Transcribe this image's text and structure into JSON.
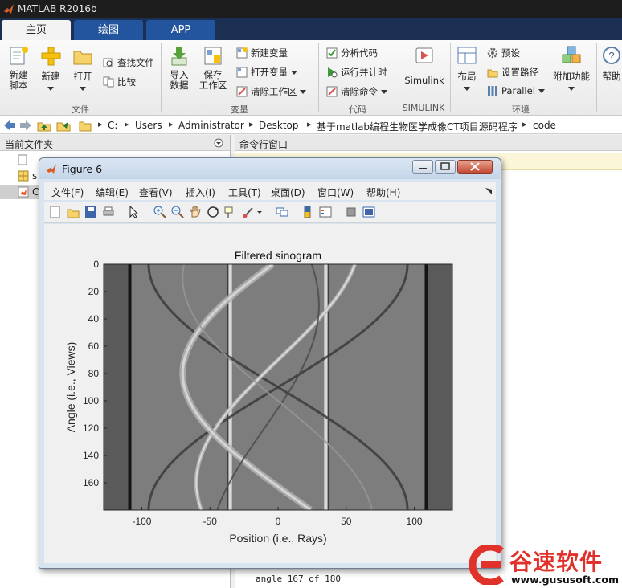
{
  "app": {
    "title": "MATLAB R2016b"
  },
  "tabs": [
    {
      "label": "主页",
      "active": true
    },
    {
      "label": "绘图",
      "active": false
    },
    {
      "label": "APP",
      "active": false
    }
  ],
  "ribbon": {
    "file": {
      "group": "文件",
      "new_script": "新建\n脚本",
      "new": "新建",
      "open": "打开",
      "find_files": "查找文件",
      "compare": "比较"
    },
    "variable": {
      "group": "变量",
      "import": "导入\n数据",
      "save_ws": "保存\n工作区",
      "new_var": "新建变量",
      "open_var": "打开变量",
      "clear_ws": "清除工作区"
    },
    "code": {
      "group": "代码",
      "analyze": "分析代码",
      "run_time": "运行并计时",
      "clear_cmd": "清除命令"
    },
    "simulink": {
      "group": "SIMULINK",
      "label": "Simulink"
    },
    "env": {
      "group": "环境",
      "layout": "布局",
      "prefs": "预设",
      "set_path": "设置路径",
      "parallel": "Parallel",
      "addons": "附加功能"
    },
    "resources": {
      "help": "帮助"
    }
  },
  "address": {
    "parts": [
      "C:",
      "Users",
      "Administrator",
      "Desktop",
      "基于matlab编程生物医学成像CT项目源码程序",
      "code"
    ]
  },
  "panels": {
    "current_folder": "当前文件夹",
    "command_window": "命令行窗口",
    "command_last_line": "angle 167 of 180",
    "file_items": [
      "s",
      "C"
    ]
  },
  "figure": {
    "title": "Figure 6",
    "menu": [
      "文件(F)",
      "编辑(E)",
      "查看(V)",
      "插入(I)",
      "工具(T)",
      "桌面(D)",
      "窗口(W)",
      "帮助(H)"
    ]
  },
  "chart_data": {
    "type": "heatmap",
    "title": "Filtered sinogram",
    "xlabel": "Position (i.e., Rays)",
    "ylabel": "Angle (i.e., Views)",
    "xlim": [
      -128,
      128
    ],
    "ylim": [
      0,
      180
    ],
    "y_reversed": true,
    "colormap": "gray",
    "xticks": [
      -100,
      -50,
      0,
      50,
      100
    ],
    "yticks": [
      0,
      20,
      40,
      60,
      80,
      100,
      120,
      140,
      160
    ],
    "grid": false
  },
  "watermark": {
    "brand": "谷速软件",
    "url": "www.gususoft.com",
    "color": "#e0322b"
  }
}
